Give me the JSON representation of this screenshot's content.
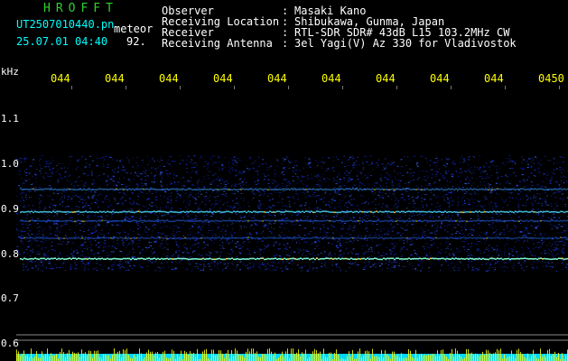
{
  "header": {
    "program": "HROFFT",
    "filename": "UT2507010440.pn",
    "meteor_label": "meteor",
    "datetime": "25.07.01 04:40",
    "count": "92.",
    "meta": [
      {
        "label": "Observer",
        "value": "Masaki Kano"
      },
      {
        "label": "Receiving Location",
        "value": "Shibukawa, Gunma, Japan"
      },
      {
        "label": "Receiver",
        "value": "RTL-SDR SDR# 43dB L15 103.2MHz CW"
      },
      {
        "label": "Receiving Antenna",
        "value": "3el Yagi(V) Az 330 for Vladivostok"
      }
    ],
    "colon": ":"
  },
  "axis": {
    "unit": "kHz",
    "y_ticks": [
      "1.1",
      "1.0",
      "0.9",
      "0.8",
      "0.7",
      "0.6"
    ],
    "time_labels": [
      "044",
      "044",
      "044",
      "044",
      "044",
      "044",
      "044",
      "044",
      "044",
      "0450"
    ]
  },
  "colors": {
    "background": "#000000",
    "header_green": "#2fd12f",
    "header_cyan": "#00ffff",
    "time_yellow": "#ffff00",
    "signal_blue": "#1a2cff",
    "strip_cyan": "#00e5ff",
    "strip_yellow": "#ffff00"
  }
}
